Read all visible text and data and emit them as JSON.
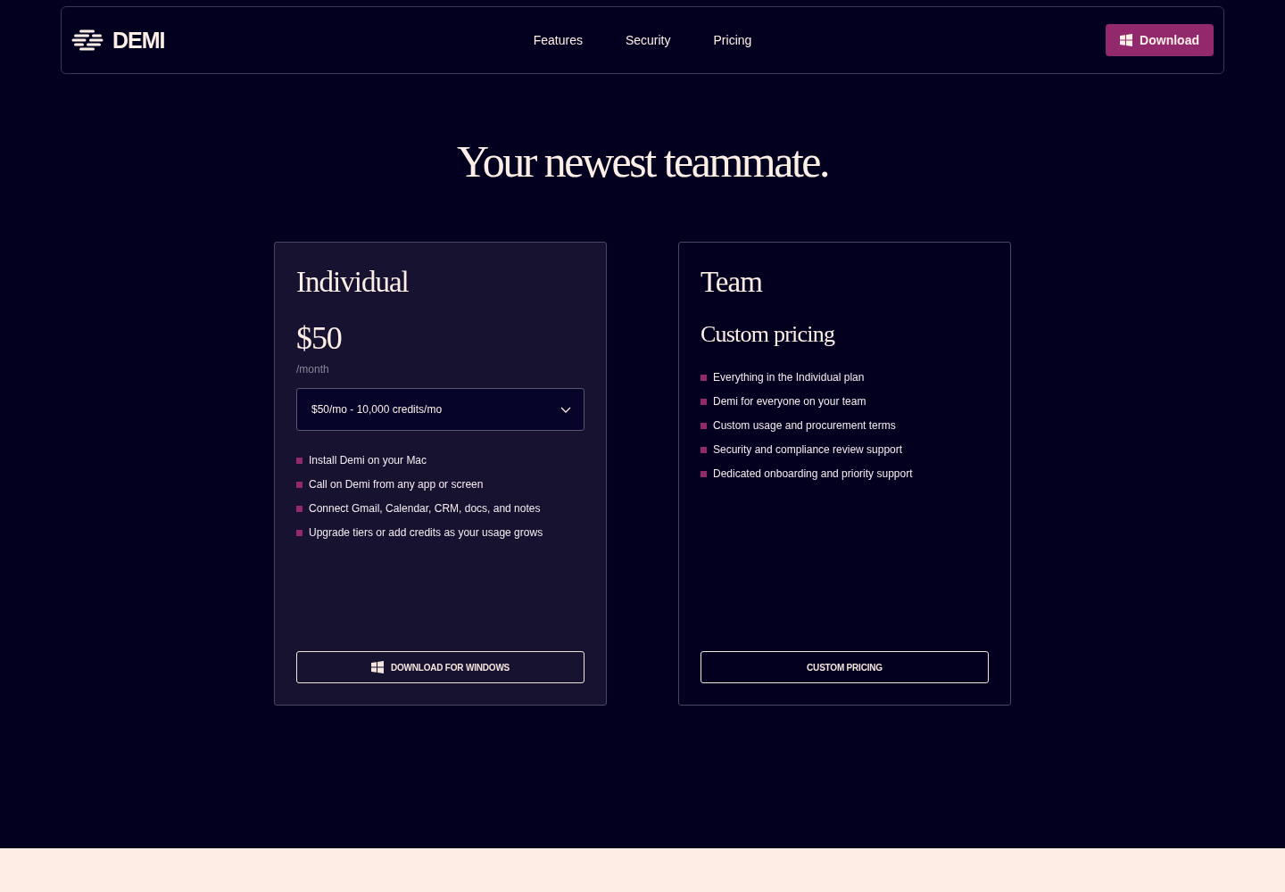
{
  "nav": {
    "brand": "DEMI",
    "links": [
      {
        "label": "Features"
      },
      {
        "label": "Security"
      },
      {
        "label": "Pricing"
      }
    ],
    "download_button": "Download"
  },
  "hero": {
    "title": "Your newest teammate."
  },
  "plans": [
    {
      "kind": "individual",
      "name": "Individual",
      "price": "$50",
      "period": "/month",
      "tier_select": {
        "value": "$50/mo - 10,000 credits/mo"
      },
      "features": [
        "Install Demi on your Mac",
        "Call on Demi from any app or screen",
        "Connect Gmail, Calendar, CRM, docs, and notes",
        "Upgrade tiers or add credits as your usage grows"
      ],
      "button": "DOWNLOAD FOR WINDOWS"
    },
    {
      "kind": "team",
      "name": "Team",
      "subtitle": "Custom pricing",
      "features": [
        "Everything in the Individual plan",
        "Demi for everyone on your team",
        "Custom usage and procurement terms",
        "Security and compliance review support",
        "Dedicated onboarding and priority support"
      ],
      "button": "CUSTOM PRICING"
    }
  ]
}
